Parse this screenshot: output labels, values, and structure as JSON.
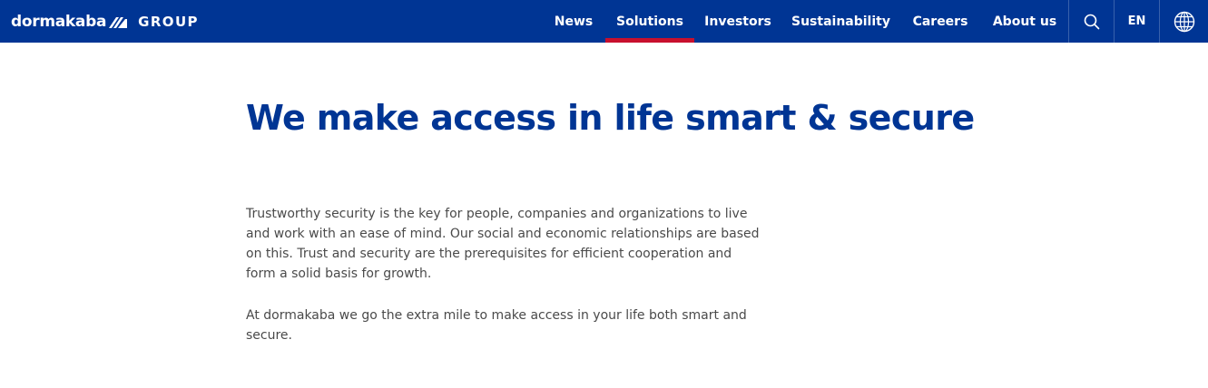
{
  "header": {
    "brand": "dormakaba",
    "group": "GROUP",
    "nav": [
      {
        "label": "News",
        "active": false
      },
      {
        "label": "Solutions",
        "active": true
      },
      {
        "label": "Investors",
        "active": false
      },
      {
        "label": "Sustainability",
        "active": false
      },
      {
        "label": "Careers",
        "active": false
      },
      {
        "label": "About us",
        "active": false
      }
    ],
    "search_icon": "search-icon",
    "language": "EN",
    "globe_icon": "globe-icon",
    "colors": {
      "bar": "#003594",
      "active_underline": "#c8102e"
    }
  },
  "main": {
    "headline": "We make access in life smart & secure",
    "paragraphs": [
      "Trustworthy security is the key for people, companies and organizations to live and work with an ease of mind. Our social and economic relationships are based on this. Trust and security are the prerequisites for efficient cooperation and form a solid basis for growth.",
      "At dormakaba we go the extra mile to make access in your life both smart and secure."
    ],
    "colors": {
      "headline": "#003594",
      "body": "#4a4a4a"
    }
  }
}
